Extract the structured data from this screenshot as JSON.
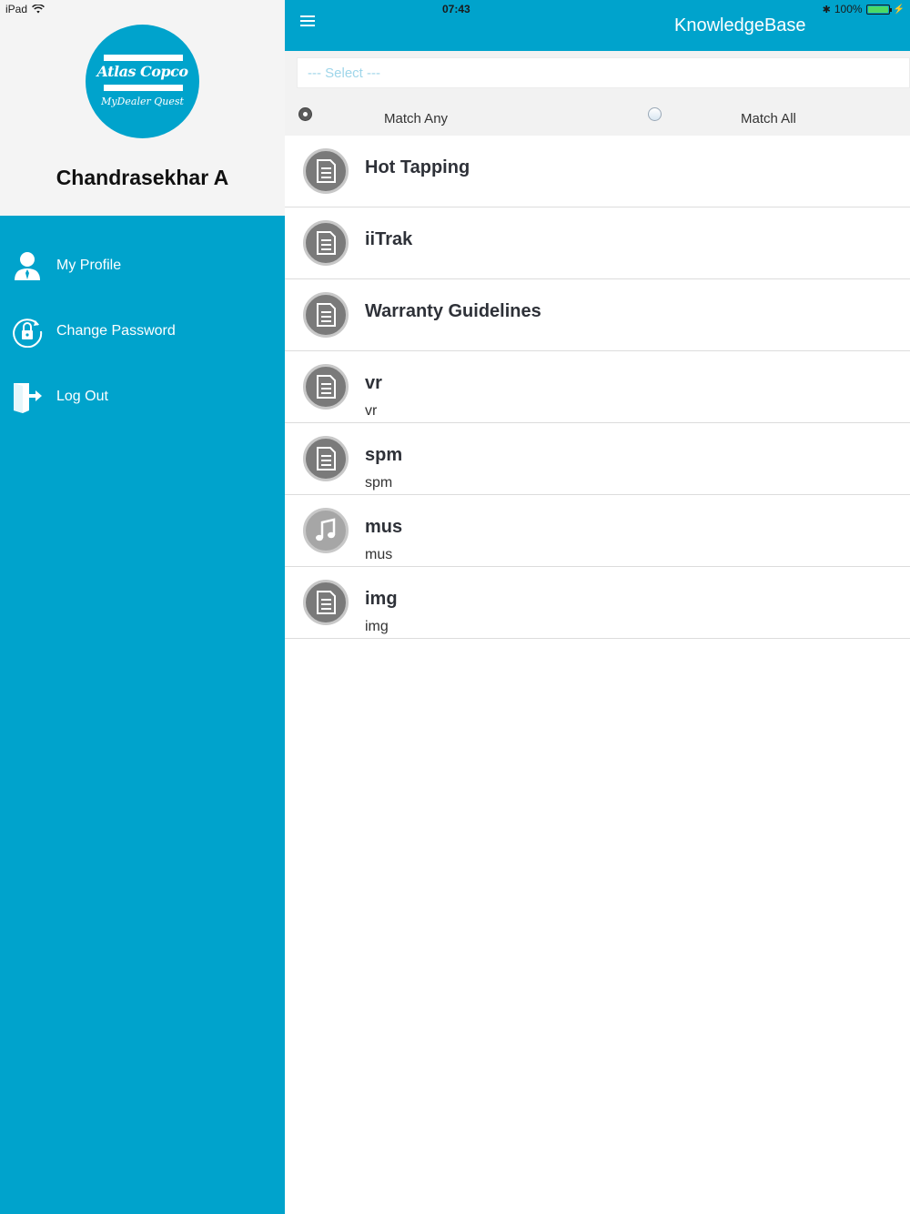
{
  "status_bar": {
    "device": "iPad",
    "time": "07:43",
    "battery": "100%"
  },
  "sidebar": {
    "logo_brand": "Atlas Copco",
    "logo_sub": "MyDealer Quest",
    "user_name": "Chandrasekhar A",
    "items": [
      {
        "label": "My Profile",
        "icon": "person-icon"
      },
      {
        "label": "Change Password",
        "icon": "lock-refresh-icon"
      },
      {
        "label": "Log Out",
        "icon": "logout-door-icon"
      }
    ]
  },
  "header": {
    "title": "KnowledgeBase"
  },
  "filter": {
    "select_placeholder": "--- Select ---",
    "match_any_label": "Match Any",
    "match_all_label": "Match All",
    "selected": "Match Any"
  },
  "list": [
    {
      "title": "Hot Tapping",
      "subtitle": "",
      "icon": "document-icon"
    },
    {
      "title": "iiTrak",
      "subtitle": "",
      "icon": "document-icon"
    },
    {
      "title": "Warranty Guidelines",
      "subtitle": "",
      "icon": "document-icon"
    },
    {
      "title": "vr",
      "subtitle": "vr",
      "icon": "document-icon"
    },
    {
      "title": "spm",
      "subtitle": "spm",
      "icon": "document-icon"
    },
    {
      "title": "mus",
      "subtitle": "mus",
      "icon": "music-note-icon"
    },
    {
      "title": "img",
      "subtitle": "img",
      "icon": "document-icon"
    }
  ],
  "colors": {
    "accent": "#00a3cc",
    "sidebar_header_bg": "#f4f4f4",
    "filter_bg": "#f2f2f2"
  }
}
